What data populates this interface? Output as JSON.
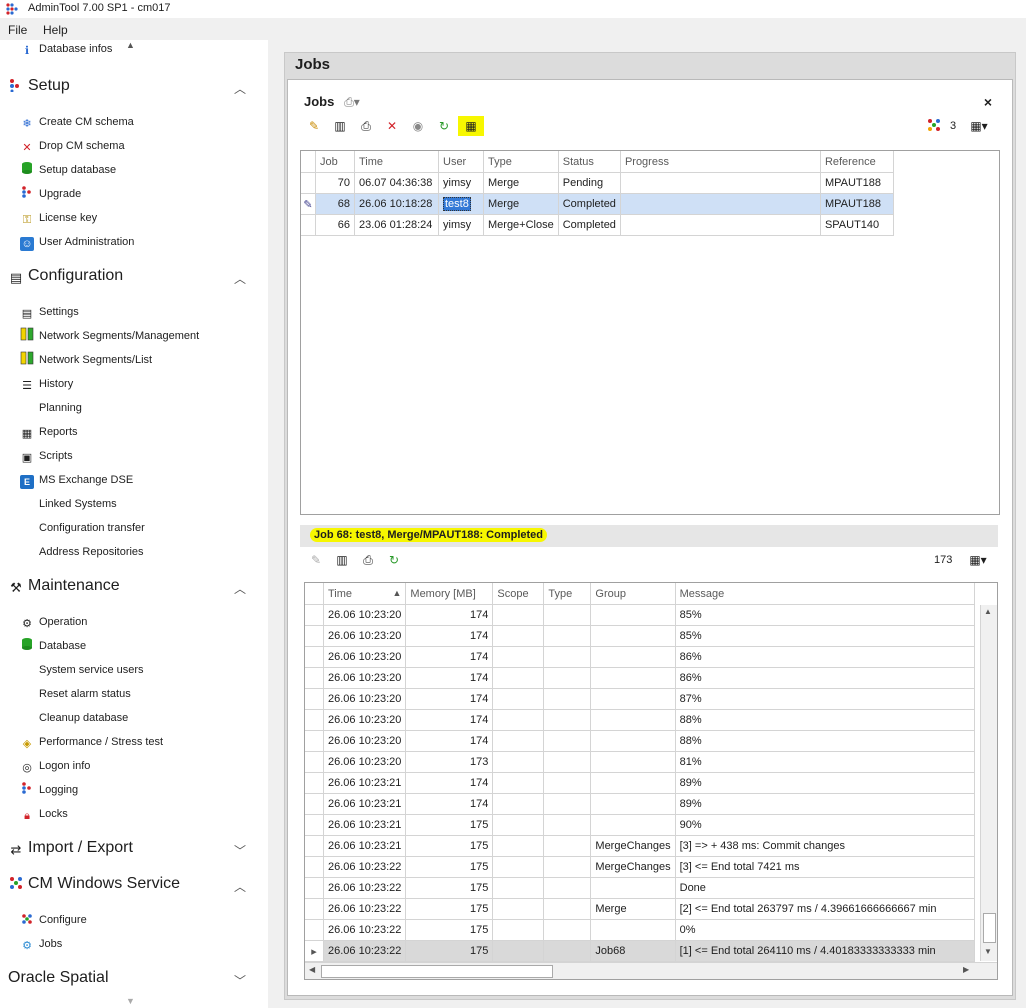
{
  "window": {
    "title": "AdminTool 7.00 SP1 - cm017"
  },
  "menu": {
    "file": "File",
    "help": "Help"
  },
  "sidebar": {
    "top_item": "Database infos",
    "sections": [
      {
        "title": "Setup",
        "items": [
          "Create CM schema",
          "Drop CM schema",
          "Setup database",
          "Upgrade",
          "License key",
          "User Administration"
        ]
      },
      {
        "title": "Configuration",
        "items": [
          "Settings",
          "Network Segments/Management",
          "Network Segments/List",
          "History",
          "Planning",
          "Reports",
          "Scripts",
          "MS Exchange DSE",
          "Linked Systems",
          "Configuration transfer",
          "Address Repositories"
        ]
      },
      {
        "title": "Maintenance",
        "items": [
          "Operation",
          "Database",
          "System service users",
          "Reset alarm status",
          "Cleanup database",
          "Performance / Stress test",
          "Logon info",
          "Logging",
          "Locks"
        ]
      },
      {
        "title": "Import / Export",
        "items": []
      },
      {
        "title": "CM Windows Service",
        "items": [
          "Configure",
          "Jobs"
        ]
      },
      {
        "title": "Oracle Spatial",
        "items": []
      }
    ]
  },
  "main": {
    "title": "Jobs",
    "panel_title": "Jobs",
    "count": "3",
    "jobs_grid": {
      "columns": [
        "Job",
        "Time",
        "User",
        "Type",
        "Status",
        "Progress",
        "Reference"
      ],
      "rows": [
        [
          "70",
          "06.07 04:36:38",
          "yimsy",
          "Merge",
          "Pending",
          "",
          "MPAUT188"
        ],
        [
          "68",
          "26.06 10:18:28",
          "test8",
          "Merge",
          "Completed",
          "",
          "MPAUT188"
        ],
        [
          "66",
          "23.06 01:28:24",
          "yimsy",
          "Merge+Close",
          "Completed",
          "",
          "SPAUT140"
        ]
      ]
    },
    "detail": {
      "title": "Job 68: test8, Merge/MPAUT188: Completed",
      "count": "173",
      "columns": [
        "Time",
        "Memory [MB]",
        "Scope",
        "Type",
        "Group",
        "Message"
      ],
      "rows": [
        [
          "26.06 10:23:20",
          "174",
          "",
          "",
          "",
          "85%"
        ],
        [
          "26.06 10:23:20",
          "174",
          "",
          "",
          "",
          "85%"
        ],
        [
          "26.06 10:23:20",
          "174",
          "",
          "",
          "",
          "86%"
        ],
        [
          "26.06 10:23:20",
          "174",
          "",
          "",
          "",
          "86%"
        ],
        [
          "26.06 10:23:20",
          "174",
          "",
          "",
          "",
          "87%"
        ],
        [
          "26.06 10:23:20",
          "174",
          "",
          "",
          "",
          "88%"
        ],
        [
          "26.06 10:23:20",
          "174",
          "",
          "",
          "",
          "88%"
        ],
        [
          "26.06 10:23:20",
          "173",
          "",
          "",
          "",
          "81%"
        ],
        [
          "26.06 10:23:21",
          "174",
          "",
          "",
          "",
          "89%"
        ],
        [
          "26.06 10:23:21",
          "174",
          "",
          "",
          "",
          "89%"
        ],
        [
          "26.06 10:23:21",
          "175",
          "",
          "",
          "",
          "90%"
        ],
        [
          "26.06 10:23:21",
          "175",
          "",
          "",
          "MergeChanges",
          "[3] =>  + 438 ms: Commit changes"
        ],
        [
          "26.06 10:23:22",
          "175",
          "",
          "",
          "MergeChanges",
          "[3] <= End  total 7421 ms"
        ],
        [
          "26.06 10:23:22",
          "175",
          "",
          "",
          "",
          "Done"
        ],
        [
          "26.06 10:23:22",
          "175",
          "",
          "",
          "Merge",
          "[2] <= End  total 263797 ms / 4.39661666666667 min"
        ],
        [
          "26.06 10:23:22",
          "175",
          "",
          "",
          "",
          "0%"
        ],
        [
          "26.06 10:23:22",
          "175",
          "",
          "",
          "Job68",
          "[1] <= End  total 264110 ms / 4.40183333333333 min"
        ]
      ]
    }
  },
  "colors": {
    "highlight": "#f7f700",
    "selection": "#cfe0f6"
  }
}
